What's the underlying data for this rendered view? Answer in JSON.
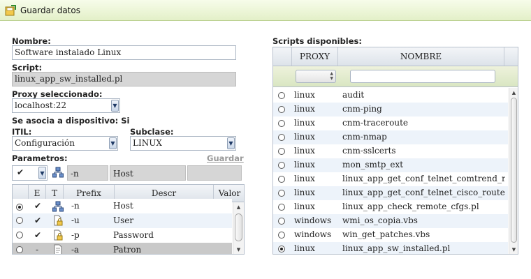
{
  "window": {
    "title": "Guardar datos"
  },
  "form": {
    "nombre_label": "Nombre:",
    "nombre_value": "Software instalado Linux",
    "script_label": "Script:",
    "script_value": "linux_app_sw_installed.pl",
    "proxy_label": "Proxy seleccionado:",
    "proxy_value": "localhost:22",
    "asocia_label": "Se asocia a dispositivo: Si",
    "itil_label": "ITIL:",
    "itil_value": "Configuración",
    "subclase_label": "Subclase:",
    "subclase_value": "LINUX",
    "parametros_label": "Parametros:",
    "guardar_link": "Guardar"
  },
  "param_editor": {
    "check_value": "✔",
    "prefix_value": "-n",
    "descr_value": "Host",
    "valor_value": ""
  },
  "params_table": {
    "headers": [
      "E",
      "T",
      "Prefix",
      "Descr",
      "Valor"
    ],
    "rows": [
      {
        "selected": true,
        "enabled": "✔",
        "prefix": "-n",
        "descr": "Host",
        "valor": ""
      },
      {
        "selected": false,
        "enabled": "✔",
        "prefix": "-u",
        "descr": "User",
        "valor": ""
      },
      {
        "selected": false,
        "enabled": "✔",
        "prefix": "-p",
        "descr": "Password",
        "valor": ""
      },
      {
        "selected": false,
        "enabled": "-",
        "prefix": "-a",
        "descr": "Patron",
        "valor": ""
      }
    ]
  },
  "scripts": {
    "label": "Scripts disponibles:",
    "headers": [
      "PROXY",
      "NOMBRE"
    ],
    "filter_proxy": "",
    "filter_nombre": "",
    "rows": [
      {
        "selected": false,
        "proxy": "linux",
        "nombre": "audit"
      },
      {
        "selected": false,
        "proxy": "linux",
        "nombre": "cnm-ping"
      },
      {
        "selected": false,
        "proxy": "linux",
        "nombre": "cnm-traceroute"
      },
      {
        "selected": false,
        "proxy": "linux",
        "nombre": "cnm-nmap"
      },
      {
        "selected": false,
        "proxy": "linux",
        "nombre": "cnm-sslcerts"
      },
      {
        "selected": false,
        "proxy": "linux",
        "nombre": "mon_smtp_ext"
      },
      {
        "selected": false,
        "proxy": "linux",
        "nombre": "linux_app_get_conf_telnet_comtrend_router.pl"
      },
      {
        "selected": false,
        "proxy": "linux",
        "nombre": "linux_app_get_conf_telnet_cisco_router.pl"
      },
      {
        "selected": false,
        "proxy": "linux",
        "nombre": "linux_app_check_remote_cfgs.pl"
      },
      {
        "selected": false,
        "proxy": "windows",
        "nombre": "wmi_os_copia.vbs"
      },
      {
        "selected": false,
        "proxy": "windows",
        "nombre": "win_get_patches.vbs"
      },
      {
        "selected": true,
        "proxy": "linux",
        "nombre": "linux_app_sw_installed.pl"
      }
    ]
  },
  "colors": {
    "titlebar": "#e3f0c8",
    "row_alt": "#edf3fa",
    "row_selected": "#c9c9c9",
    "accent": "#1f3a66"
  }
}
